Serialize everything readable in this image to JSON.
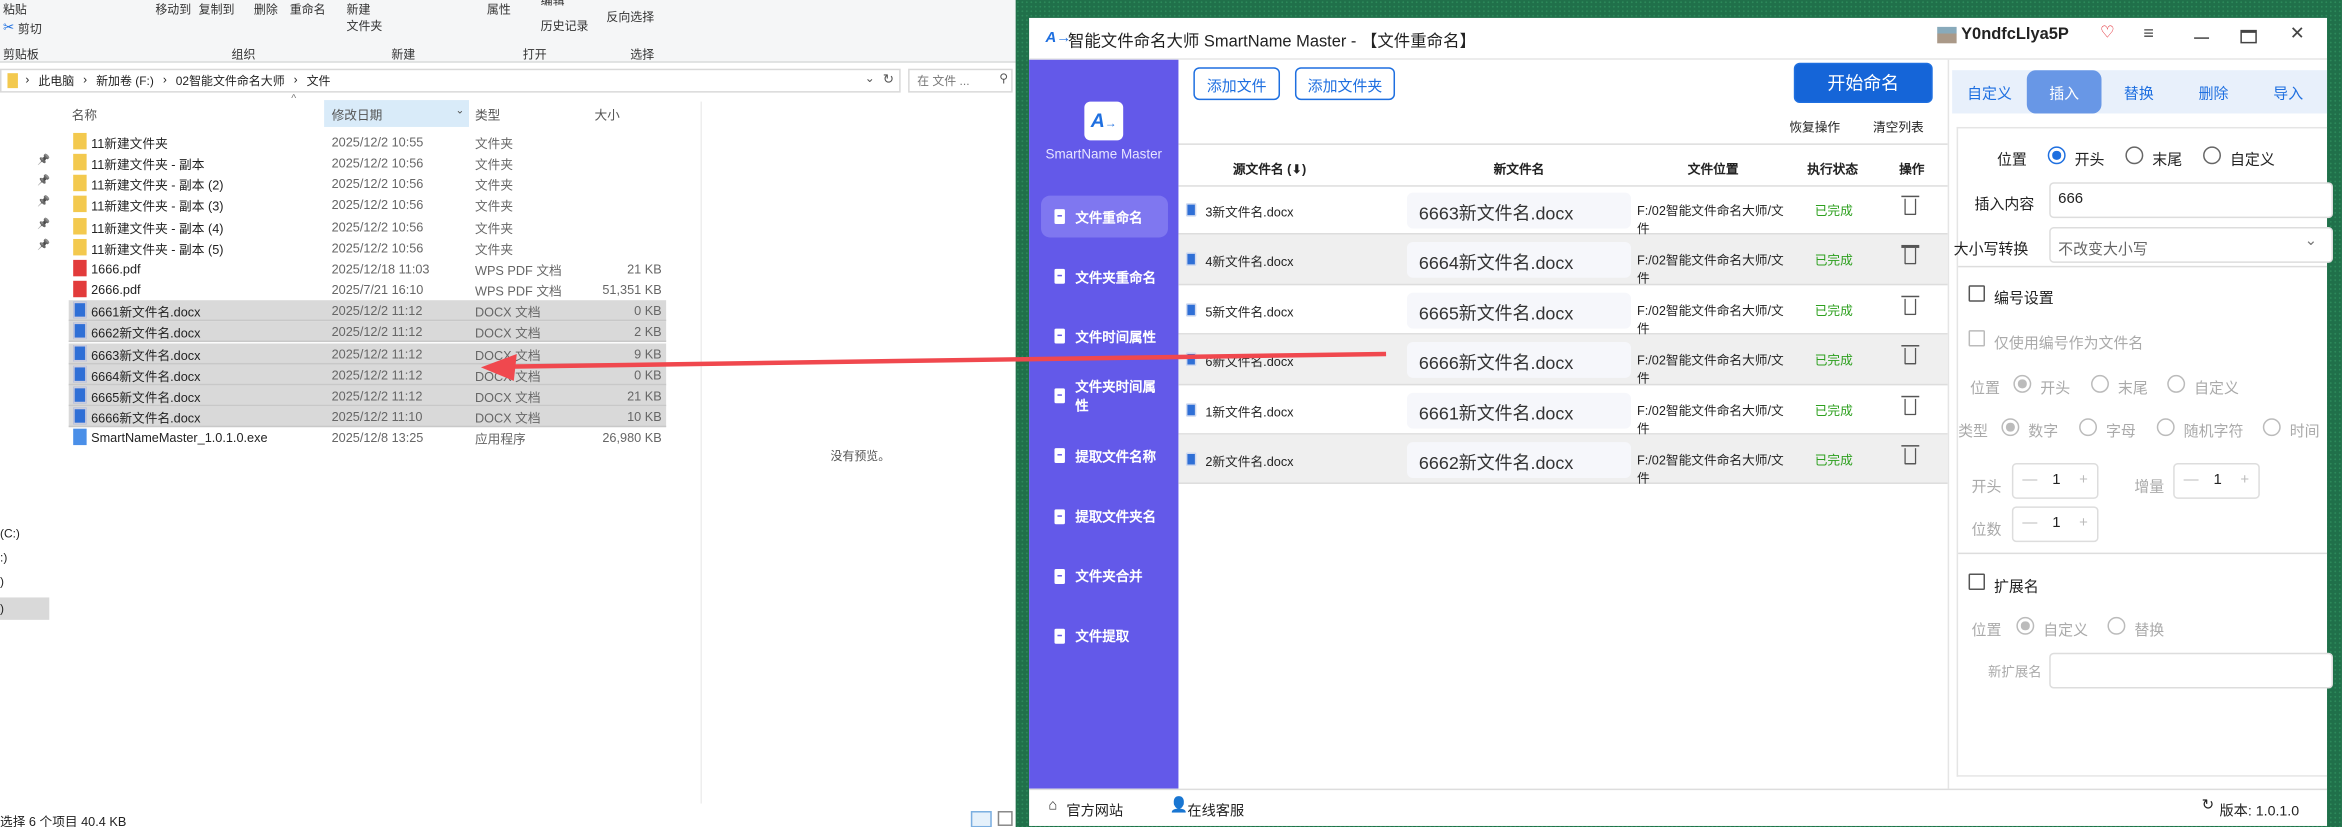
{
  "explorer": {
    "ribbon": {
      "paste": "粘贴",
      "cut": "剪切",
      "clipboard": "剪贴板",
      "move_to": "移动到",
      "copy_to": "复制到",
      "delete": "删除",
      "rename": "重命名",
      "new_folder": "新建\n文件夹",
      "organize": "组织",
      "new": "新建",
      "properties": "属性",
      "edit": "编辑",
      "history": "历史记录",
      "open": "打开",
      "invert_select": "反向选择",
      "select": "选择"
    },
    "breadcrumb": [
      "此电脑",
      "新加卷 (F:)",
      "02智能文件命名大师",
      "文件"
    ],
    "search_placeholder": "在 文件 ...",
    "columns": {
      "name": "名称",
      "date": "修改日期",
      "type": "类型",
      "size": "大小"
    },
    "files": [
      {
        "name": "11新建文件夹",
        "date": "2025/12/2 10:55",
        "type": "文件夹",
        "size": "",
        "kind": "folder",
        "sel": false
      },
      {
        "name": "11新建文件夹 - 副本",
        "date": "2025/12/2 10:56",
        "type": "文件夹",
        "size": "",
        "kind": "folder",
        "sel": false
      },
      {
        "name": "11新建文件夹 - 副本 (2)",
        "date": "2025/12/2 10:56",
        "type": "文件夹",
        "size": "",
        "kind": "folder",
        "sel": false
      },
      {
        "name": "11新建文件夹 - 副本 (3)",
        "date": "2025/12/2 10:56",
        "type": "文件夹",
        "size": "",
        "kind": "folder",
        "sel": false
      },
      {
        "name": "11新建文件夹 - 副本 (4)",
        "date": "2025/12/2 10:56",
        "type": "文件夹",
        "size": "",
        "kind": "folder",
        "sel": false
      },
      {
        "name": "11新建文件夹 - 副本 (5)",
        "date": "2025/12/2 10:56",
        "type": "文件夹",
        "size": "",
        "kind": "folder",
        "sel": false
      },
      {
        "name": "1666.pdf",
        "date": "2025/12/18 11:03",
        "type": "WPS PDF 文档",
        "size": "21 KB",
        "kind": "pdf",
        "sel": false
      },
      {
        "name": "2666.pdf",
        "date": "2025/7/21 16:10",
        "type": "WPS PDF 文档",
        "size": "51,351 KB",
        "kind": "pdf",
        "sel": false
      },
      {
        "name": "6661新文件名.docx",
        "date": "2025/12/2 11:12",
        "type": "DOCX 文档",
        "size": "0 KB",
        "kind": "docx",
        "sel": true
      },
      {
        "name": "6662新文件名.docx",
        "date": "2025/12/2 11:12",
        "type": "DOCX 文档",
        "size": "2 KB",
        "kind": "docx",
        "sel": true
      },
      {
        "name": "6663新文件名.docx",
        "date": "2025/12/2 11:12",
        "type": "DOCX 文档",
        "size": "9 KB",
        "kind": "docx",
        "sel": true
      },
      {
        "name": "6664新文件名.docx",
        "date": "2025/12/2 11:12",
        "type": "DOCX 文档",
        "size": "0 KB",
        "kind": "docx",
        "sel": true
      },
      {
        "name": "6665新文件名.docx",
        "date": "2025/12/2 11:12",
        "type": "DOCX 文档",
        "size": "21 KB",
        "kind": "docx",
        "sel": true
      },
      {
        "name": "6666新文件名.docx",
        "date": "2025/12/2 11:10",
        "type": "DOCX 文档",
        "size": "10 KB",
        "kind": "docx",
        "sel": true
      },
      {
        "name": "SmartNameMaster_1.0.1.0.exe",
        "date": "2025/12/8 13:25",
        "type": "应用程序",
        "size": "26,980 KB",
        "kind": "exe",
        "sel": false
      }
    ],
    "nav_drives": [
      "(C:)",
      ":)",
      ")",
      ")"
    ],
    "no_preview": "没有预览。",
    "status": "选择 6 个项目  40.4 KB"
  },
  "app": {
    "title": "智能文件命名大师 SmartName Master - 【文件重命名】",
    "username": "Y0ndfcLlya5P",
    "logo_text": "SmartName Master",
    "nav": [
      "文件重命名",
      "文件夹重命名",
      "文件时间属性",
      "文件夹时间属性",
      "提取文件名称",
      "提取文件夹名",
      "文件夹合并",
      "文件提取"
    ],
    "add_file": "添加文件",
    "add_folder": "添加文件夹",
    "start": "开始命名",
    "undo": "恢复操作",
    "clear": "清空列表",
    "columns": {
      "src": "源文件名 (⬇)",
      "new": "新文件名",
      "loc": "文件位置",
      "status": "执行状态",
      "op": "操作"
    },
    "rows": [
      {
        "src": "3新文件名.docx",
        "new": "6663新文件名.docx",
        "loc": "F:/02智能文件命名大师/文件",
        "status": "已完成"
      },
      {
        "src": "4新文件名.docx",
        "new": "6664新文件名.docx",
        "loc": "F:/02智能文件命名大师/文件",
        "status": "已完成"
      },
      {
        "src": "5新文件名.docx",
        "new": "6665新文件名.docx",
        "loc": "F:/02智能文件命名大师/文件",
        "status": "已完成"
      },
      {
        "src": "6新文件名.docx",
        "new": "6666新文件名.docx",
        "loc": "F:/02智能文件命名大师/文件",
        "status": "已完成"
      },
      {
        "src": "1新文件名.docx",
        "new": "6661新文件名.docx",
        "loc": "F:/02智能文件命名大师/文件",
        "status": "已完成"
      },
      {
        "src": "2新文件名.docx",
        "new": "6662新文件名.docx",
        "loc": "F:/02智能文件命名大师/文件",
        "status": "已完成"
      }
    ],
    "tabs": [
      "自定义",
      "插入",
      "替换",
      "删除",
      "导入"
    ],
    "panel": {
      "position": "位置",
      "opt_start": "开头",
      "opt_end": "末尾",
      "opt_custom": "自定义",
      "insert_label": "插入内容",
      "insert_value": "666",
      "case_label": "大小写转换",
      "case_value": "不改变大小写",
      "numbering": "编号设置",
      "only_number": "仅使用编号作为文件名",
      "type": "类型",
      "t_num": "数字",
      "t_letter": "字母",
      "t_random": "随机字符",
      "t_time": "时间",
      "start_label": "开头",
      "start_value": "1",
      "inc_label": "增量",
      "inc_value": "1",
      "digits_label": "位数",
      "digits_value": "1",
      "ext": "扩展名",
      "ext_custom": "自定义",
      "ext_replace": "替换",
      "new_ext": "新扩展名"
    },
    "footer": {
      "site": "官方网站",
      "service": "在线客服",
      "version": "版本: 1.0.1.0"
    }
  },
  "colors": {
    "sidebar": "#6359e9",
    "accent": "#1e6fe0",
    "done": "#2da01e"
  }
}
